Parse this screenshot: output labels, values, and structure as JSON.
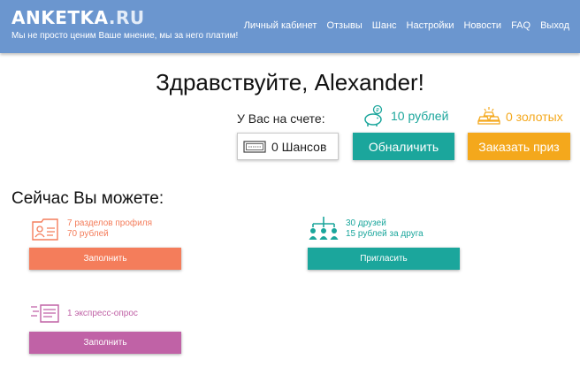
{
  "header": {
    "logo_main": "ANKETKA",
    "logo_suffix": ".RU",
    "tagline": "Мы не просто ценим Ваше мнение, мы за него платим!",
    "nav": [
      "Личный кабинет",
      "Отзывы",
      "Шанс",
      "Настройки",
      "Новости",
      "FAQ",
      "Выход"
    ]
  },
  "greeting": "Здравствуйте, Alexander!",
  "balance": {
    "label": "У Вас на счете:",
    "rubles": "10 рублей",
    "gold": "0 золотых",
    "chances": "0 Шансов",
    "cash_out_label": "Обналичить",
    "order_prize_label": "Заказать приз"
  },
  "tasks": {
    "title": "Сейчас Вы можете:",
    "profile": {
      "line1": "7 разделов профиля",
      "line2": "70 рублей",
      "button": "Заполнить"
    },
    "friends": {
      "line1": "30 друзей",
      "line2": "15 рублей за друга",
      "button": "Пригласить"
    },
    "express": {
      "line1": "1 экспресс-опрос",
      "button": "Заполнить"
    }
  },
  "colors": {
    "header_bg": "#6b96cf",
    "teal": "#1ba69c",
    "orange": "#f4a81c",
    "coral": "#f47d5b",
    "magenta": "#c062a6"
  },
  "icons": {
    "rubles": "piggy-bank-icon",
    "gold": "gold-bars-icon",
    "chances": "ticket-icon",
    "profile": "profile-card-icon",
    "friends": "referral-tree-icon",
    "express": "survey-list-icon"
  }
}
